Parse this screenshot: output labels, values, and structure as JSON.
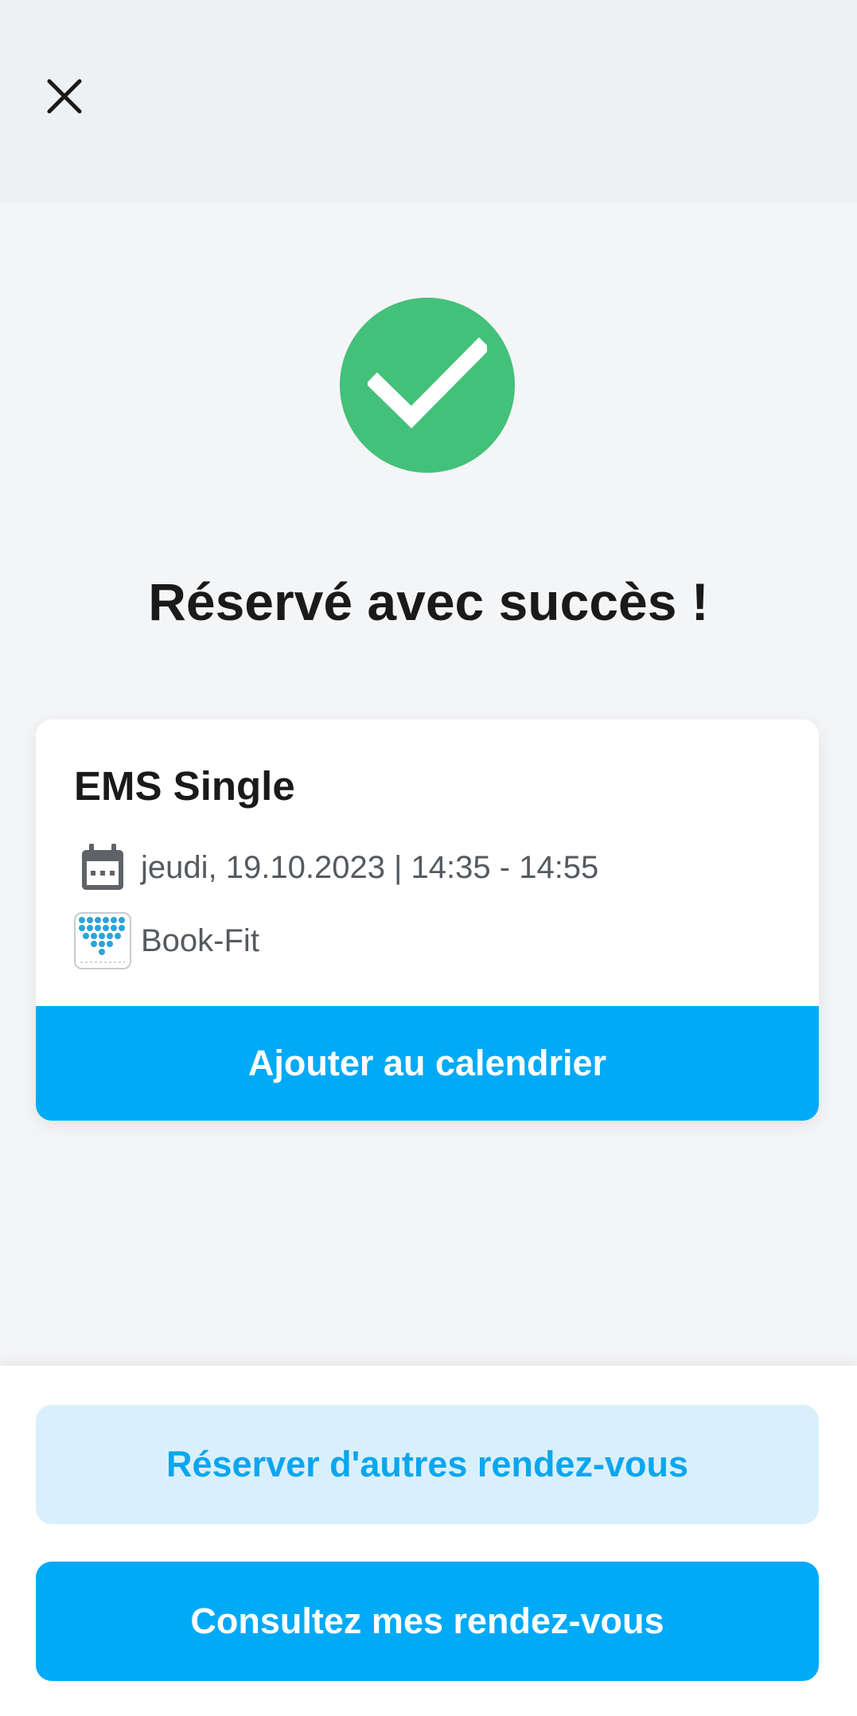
{
  "header": {
    "close_icon": "close-icon"
  },
  "status": {
    "icon": "checkmark-icon",
    "color": "#43c17a",
    "title": "Réservé avec succès !"
  },
  "booking": {
    "service_name": "EMS Single",
    "date_icon": "calendar-icon",
    "date_time": "jeudi, 19.10.2023 | 14:35 - 14:55",
    "provider_icon": "book-fit-logo-icon",
    "provider": "Book-Fit",
    "add_to_calendar_label": "Ajouter au calendrier"
  },
  "actions": {
    "book_more_label": "Réserver d'autres rendez-vous",
    "view_appointments_label": "Consultez mes rendez-vous"
  },
  "colors": {
    "accent": "#00aaf7",
    "accent_light": "#d9f0fc",
    "success": "#43c17a"
  }
}
